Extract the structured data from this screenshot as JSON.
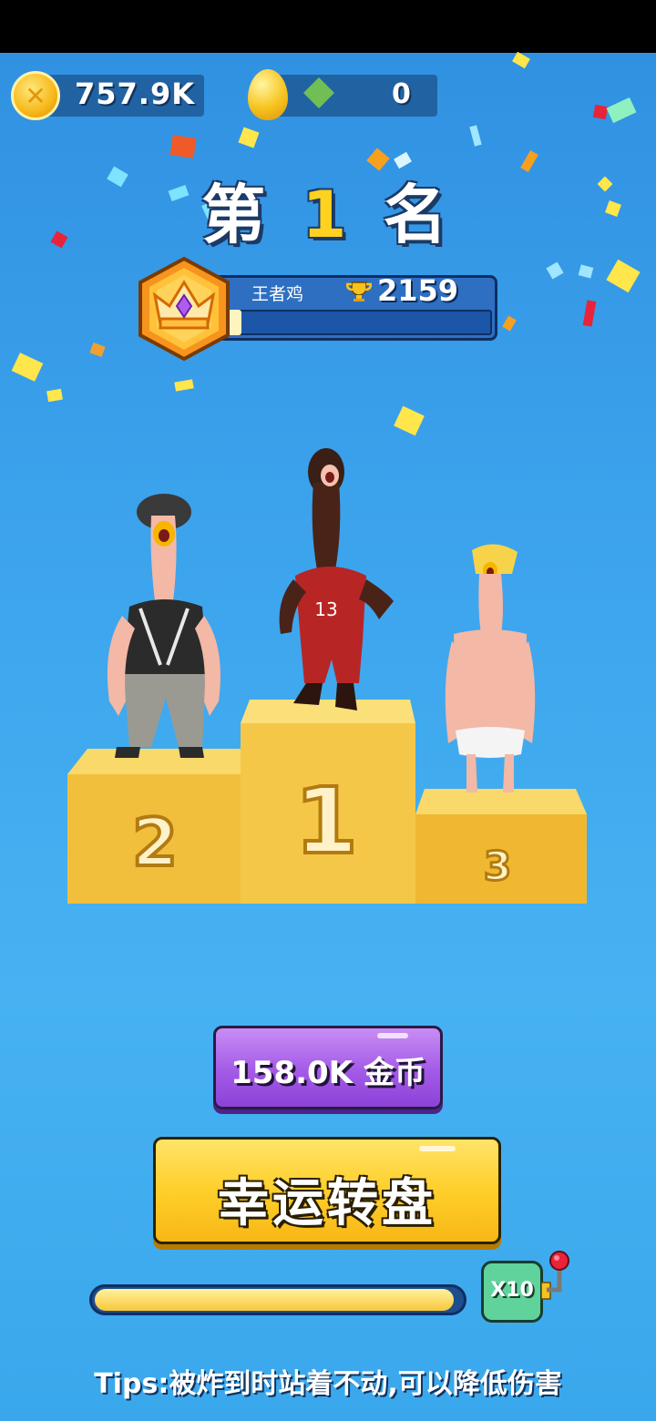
{
  "hud": {
    "coins": "757.9K",
    "gems": "0"
  },
  "rank": {
    "prefix": "第",
    "number": "1",
    "suffix": "名"
  },
  "player": {
    "name": "王者鸡",
    "trophies": "2159",
    "rank_progress": 0.05
  },
  "podium": {
    "place_labels": [
      "2",
      "1",
      "3"
    ]
  },
  "reward": {
    "prize_label": "158.0K 金币",
    "spin_label": "幸运转盘",
    "multiplier_label": "X10",
    "bonus_progress": 0.98
  },
  "tips": "Tips:被炸到时站着不动,可以降低伤害",
  "colors": {
    "background": "#3ba2ec",
    "prize_button": "#a35ae6",
    "spin_button": "#ffcf2a",
    "multiplier": "#5fd39b"
  }
}
